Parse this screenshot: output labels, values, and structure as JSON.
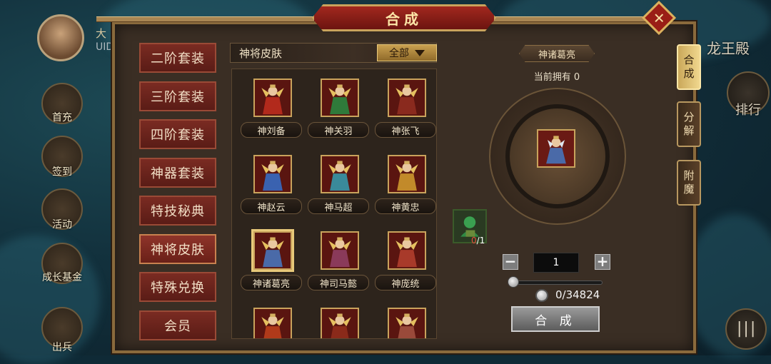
{
  "title": "合成",
  "close_icon": "close-x-icon",
  "hud": {
    "player_name": "大",
    "uid_label": "UID",
    "left_buttons": [
      "首充",
      "签到",
      "活动",
      "成长基金",
      "出兵"
    ],
    "right_top_label": "龙王殿",
    "right_rank_label": "排行"
  },
  "menu": {
    "items": [
      "二阶套装",
      "三阶套装",
      "四阶套装",
      "神器套装",
      "特技秘典",
      "神将皮肤",
      "特殊兑换",
      "会员"
    ],
    "active": "神将皮肤"
  },
  "grid": {
    "category": "神将皮肤",
    "filter_value": "全部",
    "items": [
      {
        "name": "神刘备",
        "color": "#b22a1c"
      },
      {
        "name": "神关羽",
        "color": "#2f7a3a"
      },
      {
        "name": "神张飞",
        "color": "#8a2a1e"
      },
      {
        "name": "神赵云",
        "color": "#3a62b0"
      },
      {
        "name": "神马超",
        "color": "#3a8a9a"
      },
      {
        "name": "神黄忠",
        "color": "#c28a2a"
      },
      {
        "name": "神诸葛亮",
        "color": "#4a6aa8",
        "selected": true
      },
      {
        "name": "神司马懿",
        "color": "#8a3a5a"
      },
      {
        "name": "神庞统",
        "color": "#a83a2a"
      },
      {
        "name": "",
        "color": "#b03a1a"
      },
      {
        "name": "",
        "color": "#8a2a1a"
      },
      {
        "name": "",
        "color": "#9a4a3a"
      }
    ]
  },
  "detail": {
    "hero_name": "神诸葛亮",
    "owned_label": "当前拥有 0",
    "material_have": "0",
    "material_need": "/1",
    "quantity": "1",
    "cost": "0/34824",
    "merge_label": "合 成"
  },
  "side_tabs": [
    {
      "label": "合成",
      "active": true
    },
    {
      "label": "分解",
      "active": false
    },
    {
      "label": "附魔",
      "active": false
    }
  ]
}
